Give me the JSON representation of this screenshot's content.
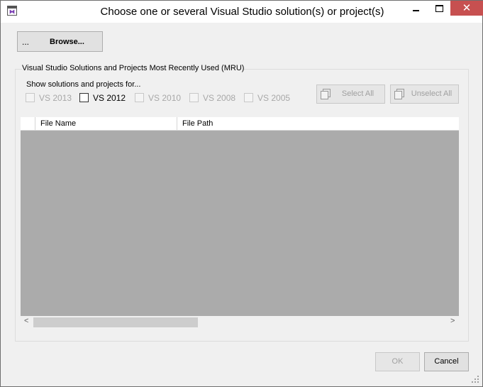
{
  "window": {
    "title": "Choose one or several Visual Studio solution(s) or project(s)",
    "icon": "visual-studio-icon",
    "controls": {
      "minimize": "minimize-icon",
      "maximize": "maximize-icon",
      "close": "✕"
    }
  },
  "browse": {
    "dots": "...",
    "label": "Browse..."
  },
  "mru_group": {
    "title": "Visual Studio Solutions and Projects Most Recently Used (MRU)",
    "show_label": "Show solutions and projects for...",
    "versions": [
      {
        "label": "VS 2013",
        "enabled": false,
        "checked": false
      },
      {
        "label": "VS 2012",
        "enabled": true,
        "checked": false
      },
      {
        "label": "VS 2010",
        "enabled": false,
        "checked": false
      },
      {
        "label": "VS 2008",
        "enabled": false,
        "checked": false
      },
      {
        "label": "VS 2005",
        "enabled": false,
        "checked": false
      }
    ],
    "select_all": "Select All",
    "unselect_all": "Unselect All"
  },
  "grid": {
    "columns": [
      "File Name",
      "File Path"
    ],
    "rows": [],
    "scroll_left": "<",
    "scroll_right": ">"
  },
  "footer": {
    "ok": "OK",
    "cancel": "Cancel"
  },
  "colors": {
    "close_button": "#c75050",
    "window_bg": "#f0f0f0",
    "grid_bg": "#ababab",
    "disabled_text": "#a8a8a8"
  }
}
